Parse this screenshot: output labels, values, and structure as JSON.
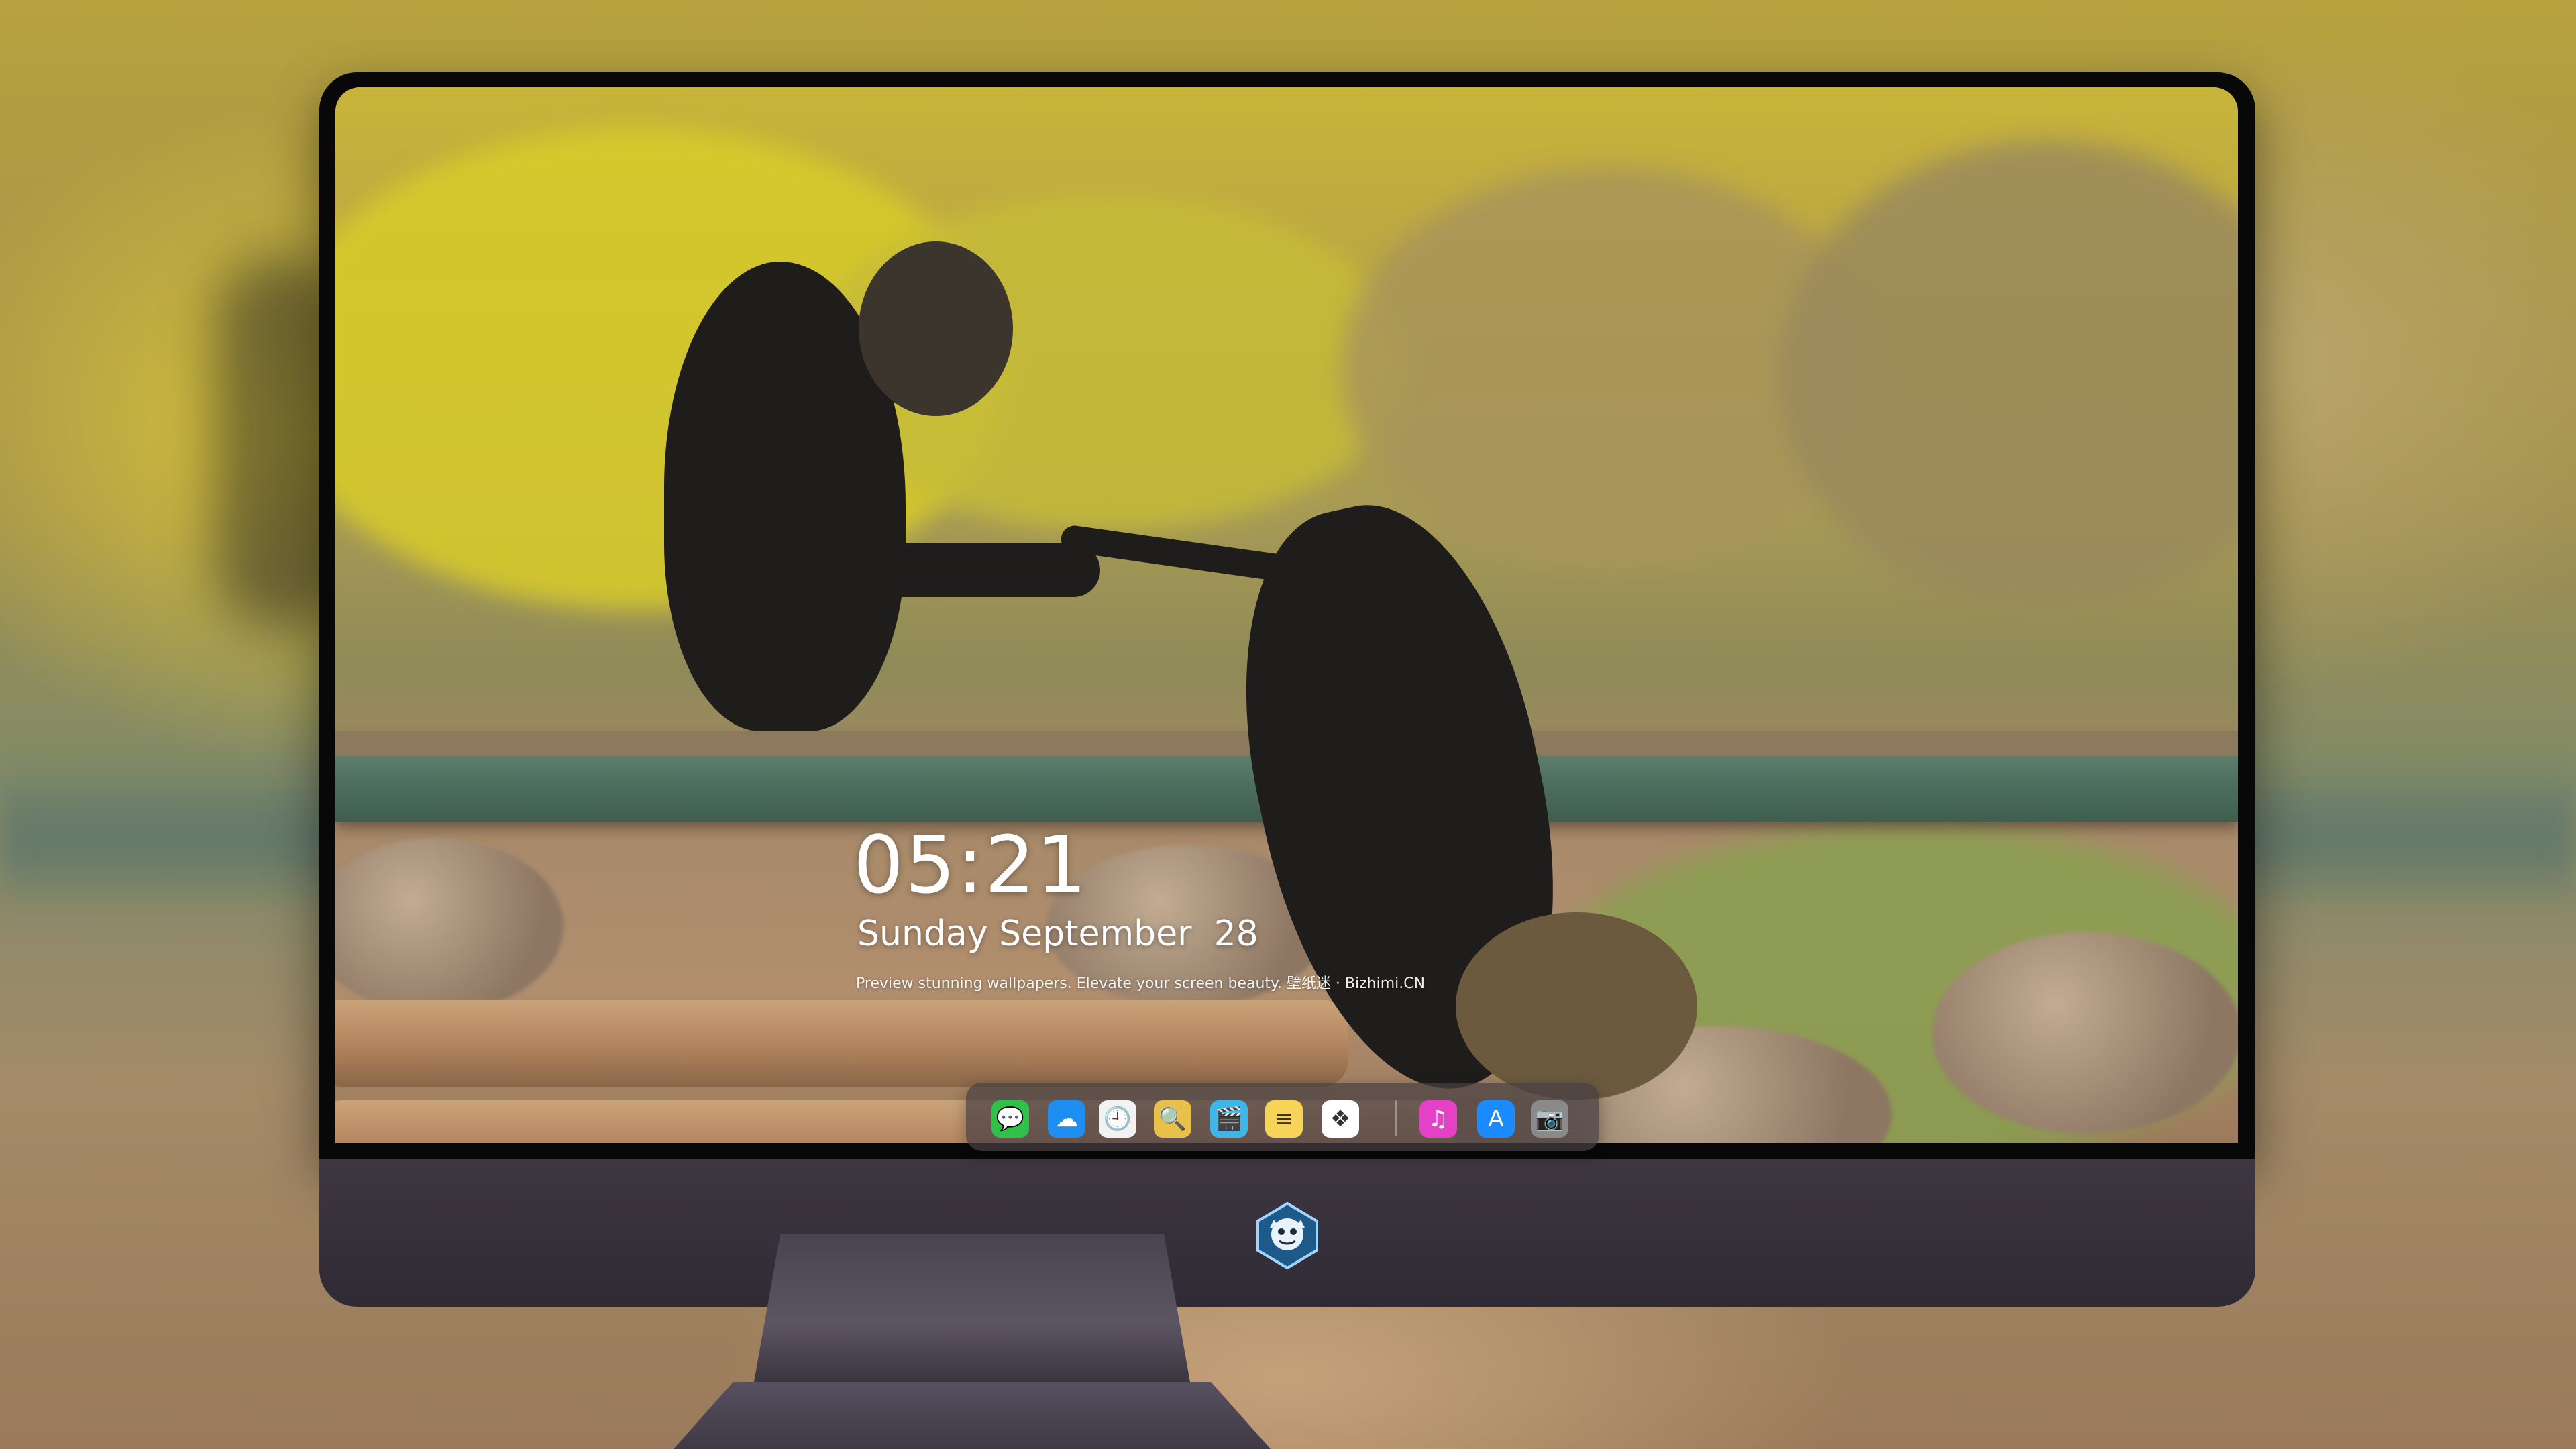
{
  "lockscreen": {
    "time": "05:21",
    "date": "Sunday September  28",
    "caption": "Preview stunning wallpapers. Elevate your screen beauty. 壁纸迷 · Bizhimi.CN"
  },
  "dock": {
    "apps": [
      {
        "name": "messages-icon",
        "glyph": "💬",
        "color": "#2fc24a"
      },
      {
        "name": "weather-icon",
        "glyph": "☁",
        "color": "#1e8ff0"
      },
      {
        "name": "clock-icon",
        "glyph": "🕘",
        "color": "#f2f2f2"
      },
      {
        "name": "preview-icon",
        "glyph": "🔍",
        "color": "#e9c04a"
      },
      {
        "name": "clips-icon",
        "glyph": "🎬",
        "color": "#3fb6e8"
      },
      {
        "name": "notes-icon",
        "glyph": "≡",
        "color": "#f7d458"
      },
      {
        "name": "photos-icon",
        "glyph": "❖",
        "color": "#ffffff"
      },
      {
        "name": "music-icon",
        "glyph": "♫",
        "color": "#e441c7"
      },
      {
        "name": "app-store-icon",
        "glyph": "A",
        "color": "#1a8cff"
      },
      {
        "name": "camera-icon",
        "glyph": "📷",
        "color": "#8a8a8a"
      }
    ]
  },
  "colors": {
    "monitor_bezel": "#080808",
    "monitor_chin": "#3e3742",
    "clock_text": "#ffffff"
  }
}
